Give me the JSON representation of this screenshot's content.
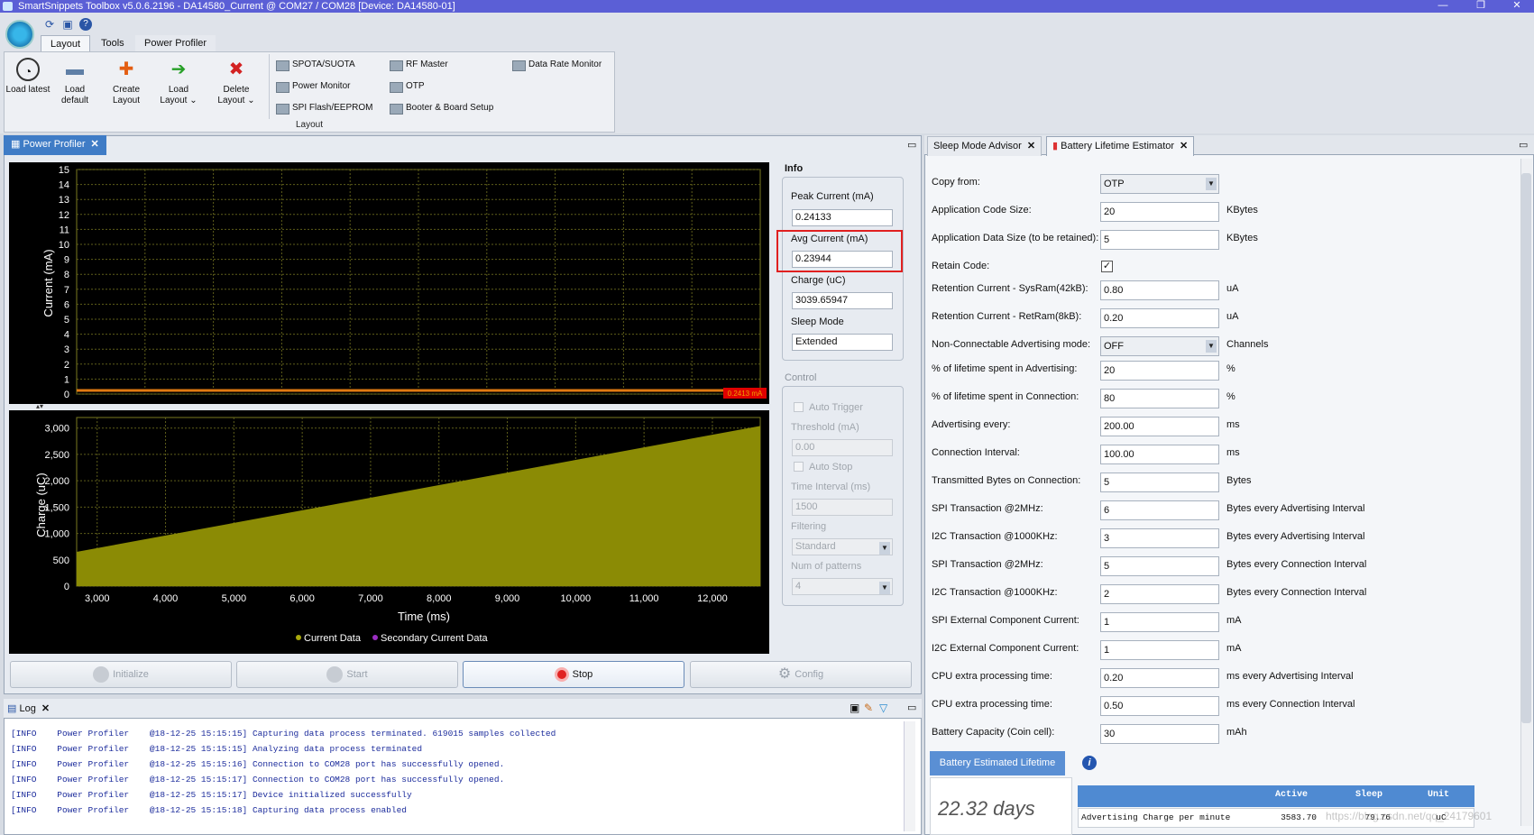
{
  "window": {
    "title": "SmartSnippets Toolbox v5.0.6.2196 - DA14580_Current @ COM27 / COM28 [Device: DA14580-01]"
  },
  "ribbon": {
    "tabs": [
      "Layout",
      "Tools",
      "Power Profiler"
    ],
    "big_buttons": [
      {
        "label": "Load latest"
      },
      {
        "label": "Load default"
      },
      {
        "label": "Create Layout"
      },
      {
        "label": "Load Layout ⌄"
      },
      {
        "label": "Delete Layout ⌄"
      }
    ],
    "small_buttons": [
      "SPOTA/SUOTA",
      "Power Monitor",
      "SPI Flash/EEPROM",
      "RF Master",
      "OTP",
      "Booter & Board Setup",
      "Data Rate Monitor"
    ],
    "group_label": "Layout"
  },
  "profiler": {
    "tab": "Power Profiler",
    "info_title": "Info",
    "peak_label": "Peak Current (mA)",
    "peak_value": "0.24133",
    "avg_label": "Avg Current (mA)",
    "avg_value": "0.23944",
    "charge_label": "Charge (uC)",
    "charge_value": "3039.65947",
    "sleep_label": "Sleep Mode",
    "sleep_value": "Extended",
    "control_title": "Control",
    "auto_trigger": "Auto Trigger",
    "threshold_label": "Threshold (mA)",
    "threshold_value": "0.00",
    "auto_stop": "Auto Stop",
    "interval_label": "Time Interval (ms)",
    "interval_value": "1500",
    "filtering_label": "Filtering",
    "filtering_value": "Standard",
    "patterns_label": "Num of patterns",
    "patterns_value": "4",
    "buttons": {
      "initialize": "Initialize",
      "start": "Start",
      "stop": "Stop",
      "config": "Config"
    }
  },
  "chart_data": [
    {
      "type": "line",
      "ylabel": "Current (mA)",
      "ylim": [
        0,
        15
      ],
      "yticks": [
        "0",
        "1",
        "2",
        "3",
        "4",
        "5",
        "6",
        "7",
        "8",
        "9",
        "10",
        "11",
        "12",
        "13",
        "14",
        "15"
      ],
      "series": [
        {
          "name": "Current Data",
          "x": [
            2700,
            12700
          ],
          "values": [
            0.2413,
            0.2413
          ]
        }
      ],
      "marker_label": "0.2413 mA",
      "grid": true,
      "color": "#e07a12"
    },
    {
      "type": "area",
      "xlabel": "Time (ms)",
      "ylabel": "Charge (uC)",
      "xlim": [
        2700,
        12700
      ],
      "ylim": [
        0,
        3200
      ],
      "xticks": [
        "3,000",
        "4,000",
        "5,000",
        "6,000",
        "7,000",
        "8,000",
        "9,000",
        "10,000",
        "11,000",
        "12,000"
      ],
      "yticks": [
        "0",
        "500",
        "1,000",
        "1,500",
        "2,000",
        "2,500",
        "3,000"
      ],
      "series": [
        {
          "name": "Current Data",
          "x": [
            2700,
            12700
          ],
          "values": [
            650,
            3040
          ]
        }
      ],
      "legend": [
        "Current Data",
        "Secondary Current Data"
      ],
      "legend_position": "bottom",
      "color": "#8b8b05"
    }
  ],
  "log": {
    "tab": "Log",
    "lines": [
      "[INFO    Power Profiler    @18-12-25 15:15:15] Capturing data process terminated. 619015 samples collected",
      "[INFO    Power Profiler    @18-12-25 15:15:15] Analyzing data process terminated",
      "[INFO    Power Profiler    @18-12-25 15:15:16] Connection to COM28 port has successfully opened.",
      "[INFO    Power Profiler    @18-12-25 15:15:17] Connection to COM28 port has successfully opened.",
      "[INFO    Power Profiler    @18-12-25 15:15:17] Device initialized successfully",
      "[INFO    Power Profiler    @18-12-25 15:15:18] Capturing data process enabled"
    ]
  },
  "estimator": {
    "tabs": [
      "Sleep Mode Advisor",
      "Battery Lifetime Estimator"
    ],
    "rows": [
      {
        "label": "Copy from:",
        "value": "OTP",
        "unit": "",
        "select": true
      },
      {
        "label": "Application Code Size:",
        "value": "20",
        "unit": "KBytes"
      },
      {
        "label": "Application Data Size (to be retained):",
        "value": "5",
        "unit": "KBytes"
      },
      {
        "label": "Retain Code:",
        "value": "✓",
        "unit": "",
        "checkbox": true
      },
      {
        "label": "Retention Current - SysRam(42kB):",
        "value": "0.80",
        "unit": "uA"
      },
      {
        "label": "Retention Current - RetRam(8kB):",
        "value": "0.20",
        "unit": "uA"
      },
      {
        "label": "Non-Connectable Advertising mode:",
        "value": "OFF",
        "unit": "Channels",
        "select": true
      },
      {
        "label": "% of lifetime spent in Advertising:",
        "value": "20",
        "unit": "%"
      },
      {
        "label": "% of lifetime spent in Connection:",
        "value": "80",
        "unit": "%"
      },
      {
        "label": "Advertising every:",
        "value": "200.00",
        "unit": "ms"
      },
      {
        "label": "Connection Interval:",
        "value": "100.00",
        "unit": "ms"
      },
      {
        "label": "Transmitted Bytes on Connection:",
        "value": "5",
        "unit": "Bytes"
      },
      {
        "label": "SPI Transaction @2MHz:",
        "value": "6",
        "unit": "Bytes every Advertising Interval"
      },
      {
        "label": "I2C Transaction @1000KHz:",
        "value": "3",
        "unit": "Bytes every Advertising Interval"
      },
      {
        "label": "SPI Transaction @2MHz:",
        "value": "5",
        "unit": "Bytes every Connection Interval"
      },
      {
        "label": "I2C Transaction @1000KHz:",
        "value": "2",
        "unit": "Bytes every Connection Interval"
      },
      {
        "label": "SPI External Component Current:",
        "value": "1",
        "unit": "mA"
      },
      {
        "label": "I2C External Component Current:",
        "value": "1",
        "unit": "mA"
      },
      {
        "label": "CPU extra processing time:",
        "value": "0.20",
        "unit": "ms every Advertising Interval"
      },
      {
        "label": "CPU extra processing time:",
        "value": "0.50",
        "unit": "ms every Connection Interval"
      },
      {
        "label": "Battery Capacity (Coin cell):",
        "value": "30",
        "unit": "mAh"
      }
    ],
    "lifetime_label": "Battery Estimated Lifetime",
    "lifetime_value": "22.32 days",
    "table": {
      "headers": [
        "",
        "Active",
        "Sleep",
        "Unit"
      ],
      "row": [
        "Advertising Charge per minute",
        "3583.70",
        "79.76",
        "uC"
      ]
    },
    "watermark": "https://blog.csdn.net/qq_24179601"
  }
}
